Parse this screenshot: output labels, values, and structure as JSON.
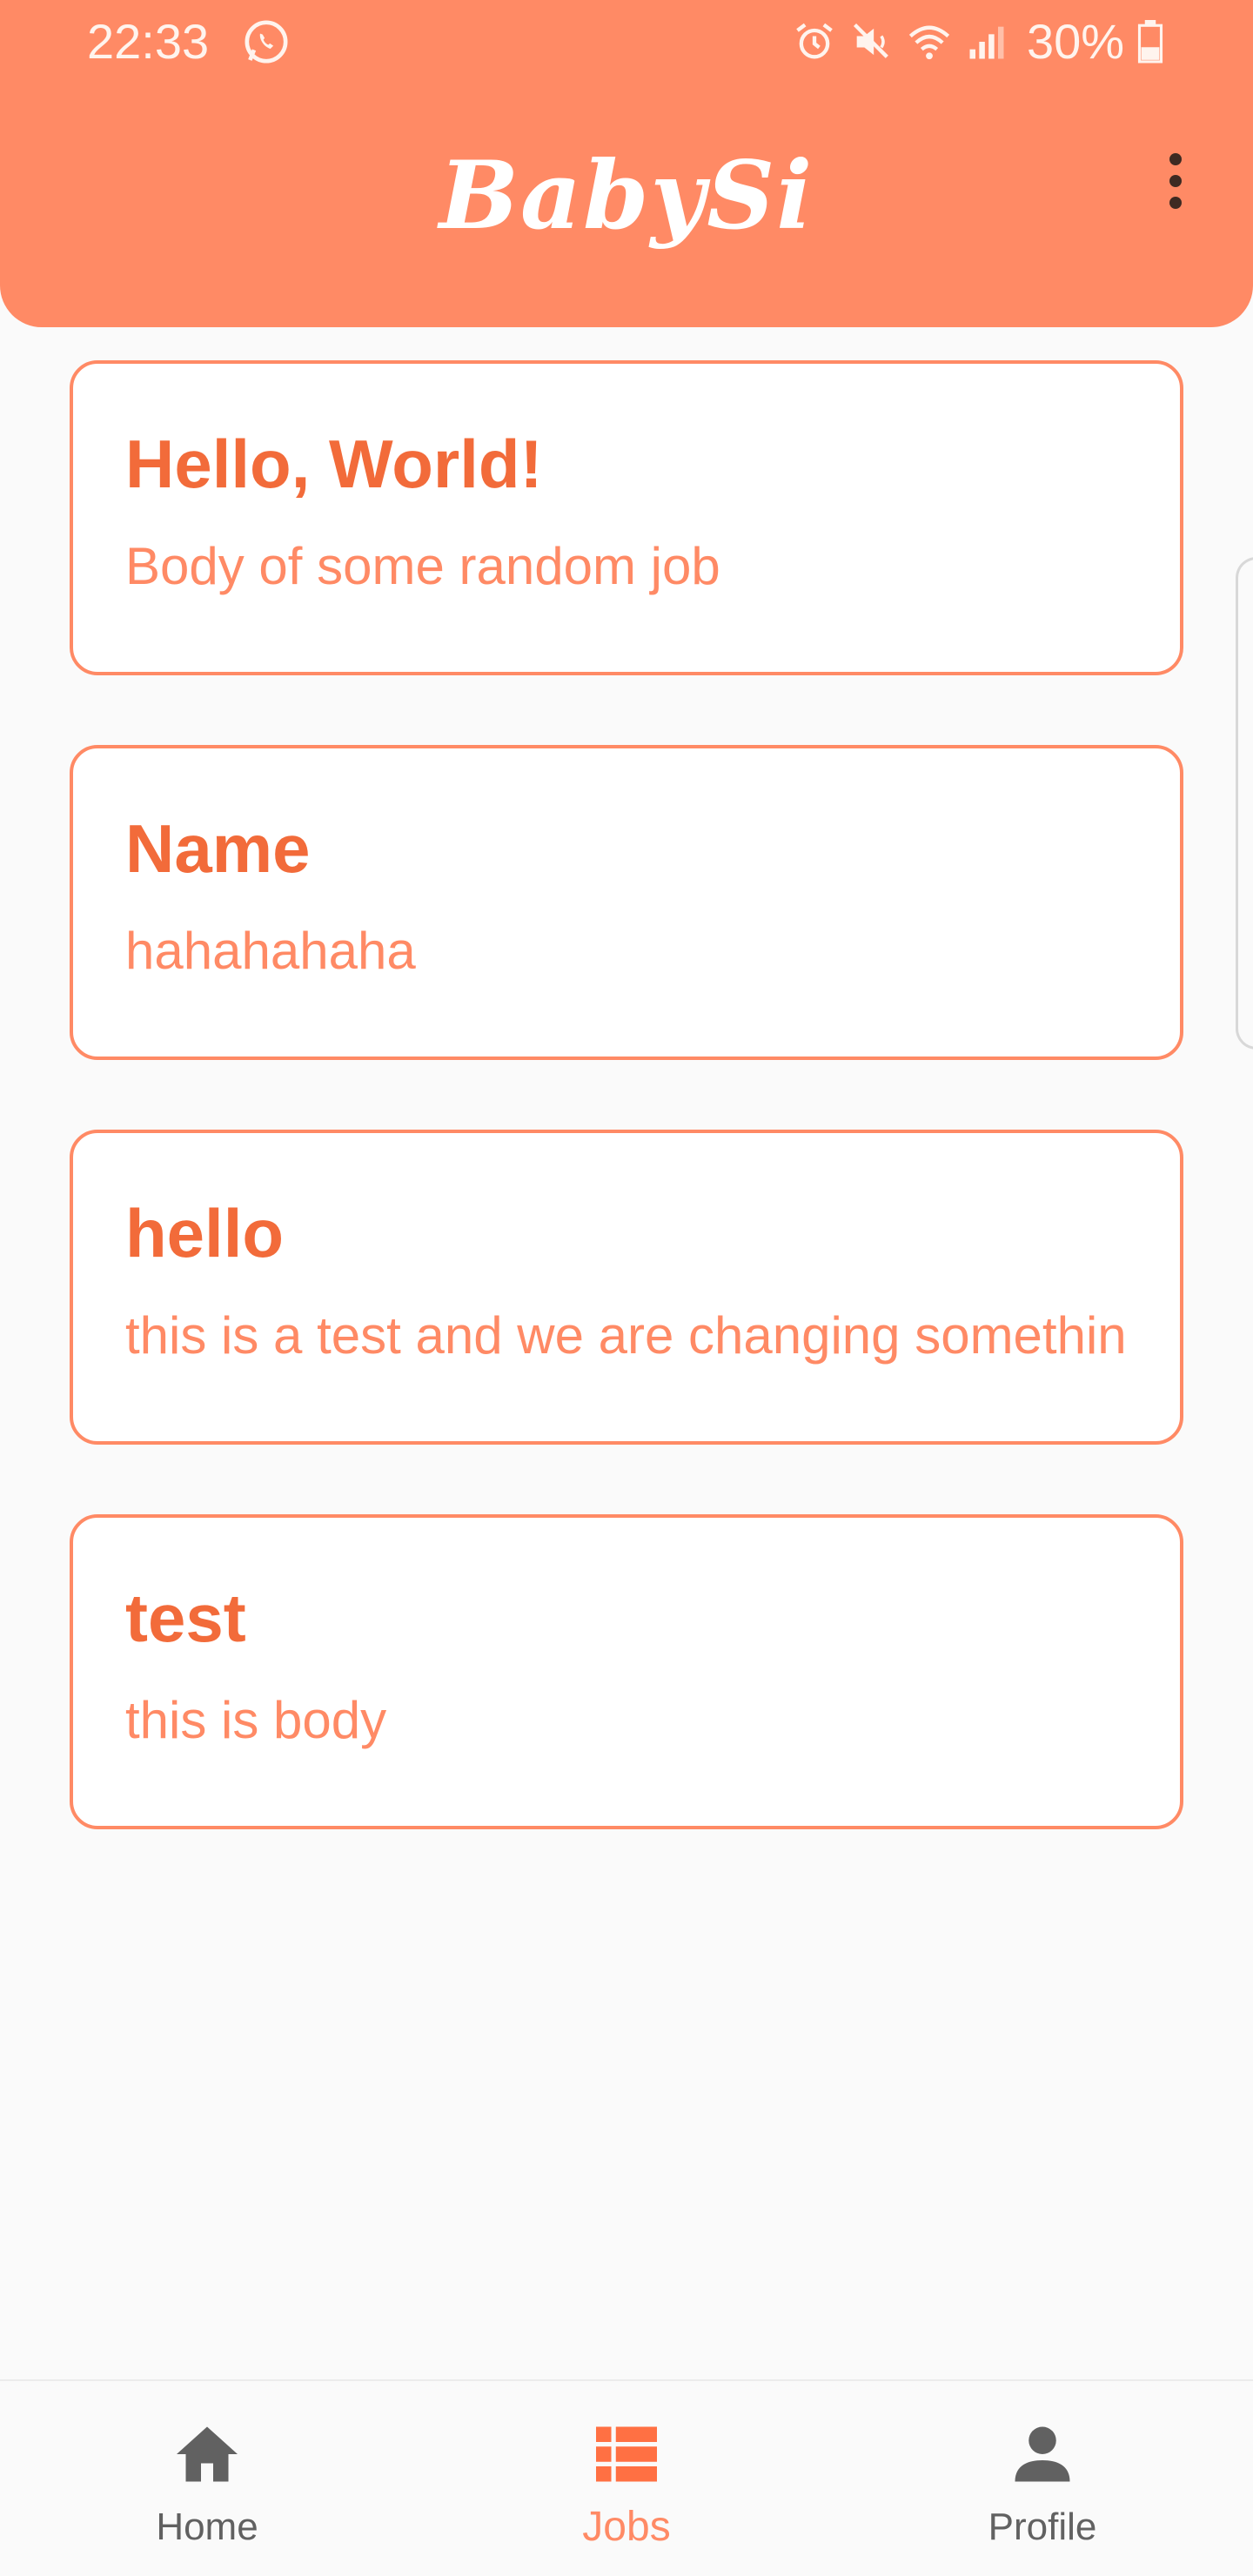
{
  "status_bar": {
    "time": "22:33",
    "battery": "30%",
    "icons": [
      "whatsapp-icon",
      "alarm-icon",
      "mute-icon",
      "wifi-icon",
      "signal-icon",
      "battery-icon"
    ]
  },
  "app_bar": {
    "title": "BabySi",
    "menu_icon": "more-vert-icon"
  },
  "jobs": [
    {
      "title": "Hello, World!",
      "body": "Body of some random job"
    },
    {
      "title": "Name",
      "body": "hahahahaha"
    },
    {
      "title": "hello",
      "body": "this is a test and we are changing somethingg"
    },
    {
      "title": "test",
      "body": "this is body"
    }
  ],
  "bottom_nav": {
    "items": [
      {
        "label": "Home",
        "icon": "home-icon",
        "active": false
      },
      {
        "label": "Jobs",
        "icon": "list-icon",
        "active": true
      },
      {
        "label": "Profile",
        "icon": "person-icon",
        "active": false
      }
    ]
  },
  "colors": {
    "accent": "#ff8a65",
    "title_text": "#f26b3a",
    "inactive_nav": "#616161",
    "background": "#fafafa"
  }
}
